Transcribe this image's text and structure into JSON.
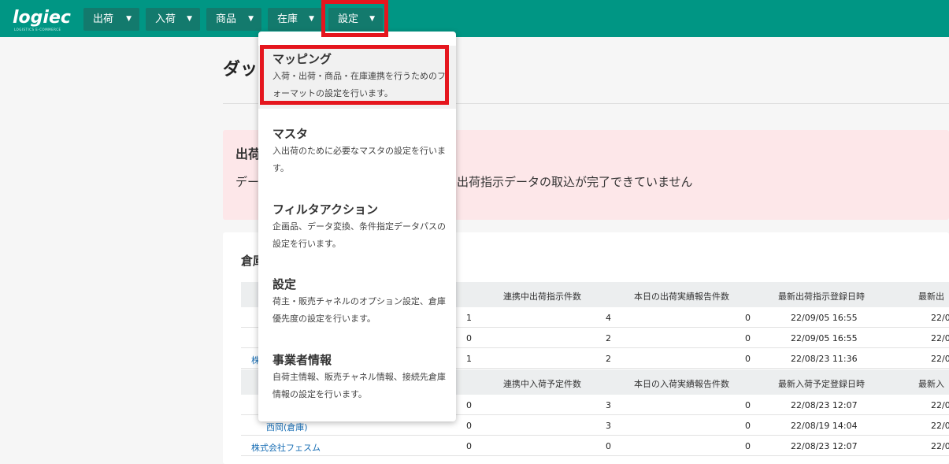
{
  "app": {
    "logo_text": "logiec",
    "logo_sub": "LOGISTICS E-COMMERCE"
  },
  "nav": [
    {
      "label": "出荷"
    },
    {
      "label": "入荷"
    },
    {
      "label": "商品"
    },
    {
      "label": "在庫"
    },
    {
      "label": "設定"
    }
  ],
  "nav_caret": "▼",
  "page": {
    "title": "ダッ"
  },
  "alert": {
    "title": "出荷",
    "text_left": "デー",
    "text_right": "出荷指示データの取込が完了できていません"
  },
  "card": {
    "title": "倉庫"
  },
  "shipping_table": {
    "headers": [
      "連携中出荷指示件数",
      "本日の出荷実績報告件数",
      "最新出荷指示登録日時",
      "最新出"
    ],
    "rows": [
      {
        "name": "",
        "a": "1",
        "b": "4",
        "c": "0",
        "d": "22/09/05 16:55",
        "e": "22/0"
      },
      {
        "name": "",
        "a": "0",
        "b": "2",
        "c": "0",
        "d": "22/09/05 16:55",
        "e": "22/0"
      },
      {
        "name": "株",
        "a": "1",
        "b": "2",
        "c": "0",
        "d": "22/08/23 11:36",
        "e": "22/0"
      }
    ]
  },
  "receiving_table": {
    "headers": [
      "連携中入荷予定件数",
      "本日の入荷実績報告件数",
      "最新入荷予定登録日時",
      "最新入"
    ],
    "rows": [
      {
        "name": "",
        "a": "0",
        "b": "3",
        "c": "0",
        "d": "22/08/23 12:07",
        "e": "22/0"
      },
      {
        "name": "西岡(倉庫)",
        "a": "0",
        "b": "3",
        "c": "0",
        "d": "22/08/19 14:04",
        "e": "22/0"
      },
      {
        "name": "株式会社フェスム",
        "a": "0",
        "b": "0",
        "c": "0",
        "d": "22/08/23 12:07",
        "e": "22/0"
      }
    ]
  },
  "dropdown": {
    "items": [
      {
        "title": "マッピング",
        "desc": "入荷・出荷・商品・在庫連携を行うためのフォーマットの設定を行います。"
      },
      {
        "title": "マスタ",
        "desc": "入出荷のために必要なマスタの設定を行います。"
      },
      {
        "title": "フィルタアクション",
        "desc": "企画品、データ変換、条件指定データパスの設定を行います。"
      },
      {
        "title": "設定",
        "desc": "荷主・販売チャネルのオプション設定、倉庫優先度の設定を行います。"
      },
      {
        "title": "事業者情報",
        "desc": "自荷主情報、販売チャネル情報、接続先倉庫情報の設定を行います。"
      }
    ]
  },
  "colors": {
    "topbar": "#009684",
    "nav_button": "#137a6d",
    "highlight": "#e5161e",
    "alert_bg": "#fde7e9",
    "link": "#1a6fb5"
  }
}
